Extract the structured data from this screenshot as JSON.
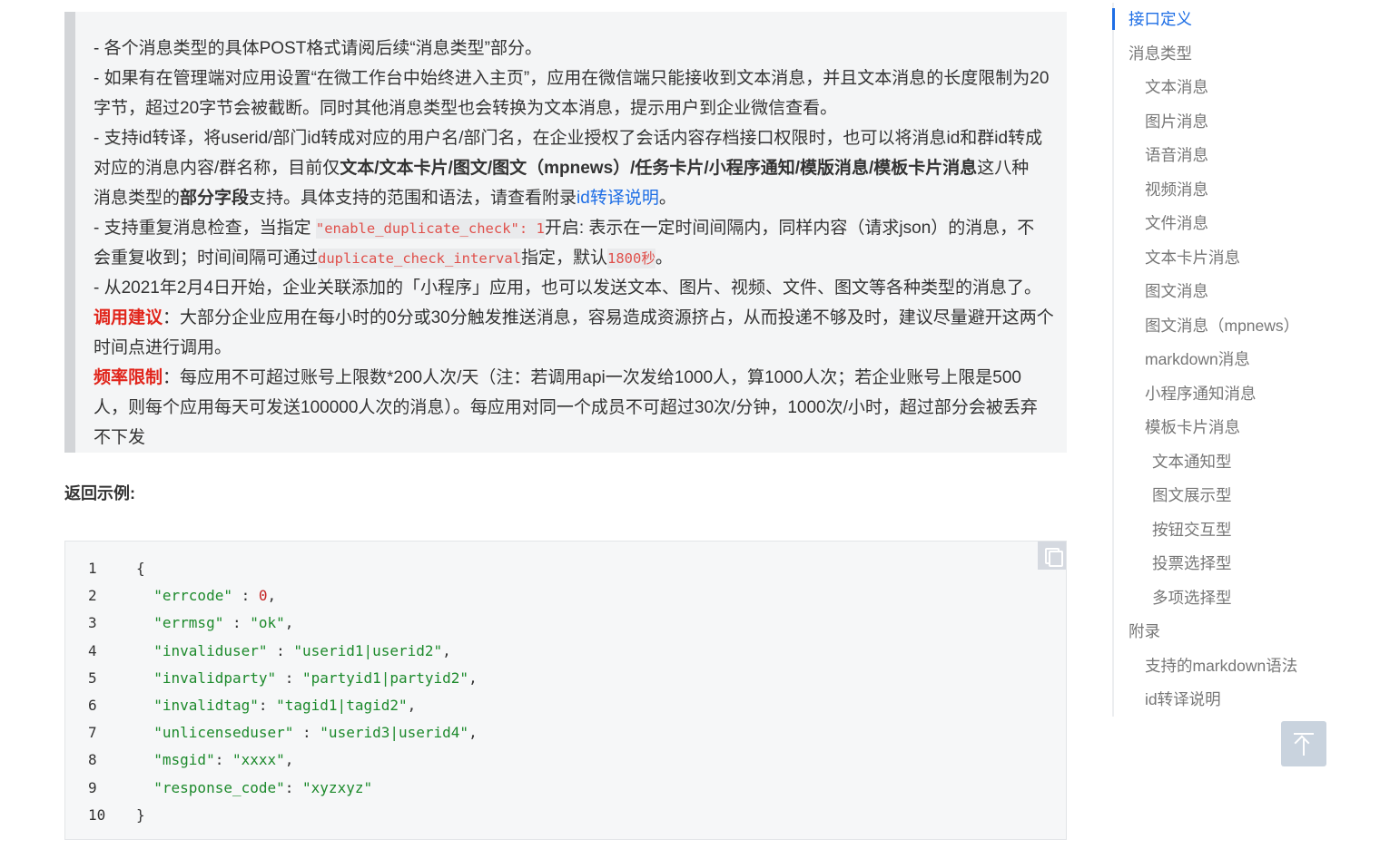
{
  "notice": {
    "line1": "- 各个消息类型的具体POST格式请阅后续“消息类型”部分。",
    "line2": "- 如果有在管理端对应用设置“在微工作台中始终进入主页”，应用在微信端只能接收到文本消息，并且文本消息的长度限制为20",
    "line3": "字节，超过20字节会被截断。同时其他消息类型也会转换为文本消息，提示用户到企业微信查看。",
    "line4": "- 支持id转译，将userid/部门id转成对应的用户名/部门名，在企业授权了会话内容存档接口权限时，也可以将消息id和群id转成",
    "line5_a": "对应的消息内容/群名称，目前仅",
    "line5_b": "文本/文本卡片/图文/图文（mpnews）/任务卡片/小程序通知/模版消息/模板卡片消息",
    "line5_c": "这八种",
    "line6_a": "消息类型的",
    "line6_b": "部分字段",
    "line6_c": "支持。具体支持的范围和语法，请查看附录",
    "line6_link": "id转译说明",
    "line6_d": "。",
    "line7_a": "- 支持重复消息检查，当指定 ",
    "line7_code": "\"enable_duplicate_check\": 1",
    "line7_b": "开启: 表示在一定时间间隔内，同样内容（请求json）的消息，不",
    "line8_a": "会重复收到；时间间隔可通过",
    "line8_code": "duplicate_check_interval",
    "line8_b": "指定，默认",
    "line8_code2": "1800秒",
    "line8_c": "。",
    "line9": "- 从2021年2月4日开始，企业关联添加的「小程序」应用，也可以发送文本、图片、视频、文件、图文等各种类型的消息了。",
    "line10_label": "调用建议",
    "line10_text": "：大部分企业应用在每小时的0分或30分触发推送消息，容易造成资源挤占，从而投递不够及时，建议尽量避开这两个",
    "line11": "时间点进行调用。",
    "line12_label": "频率限制",
    "line12_text": "：每应用不可超过账号上限数*200人次/天（注：若调用api一次发给1000人，算1000人次；若企业账号上限是500",
    "line13": "人，则每个应用每天可发送100000人次的消息）。每应用对同一个成员不可超过30次/分钟，1000次/小时，超过部分会被丢弃",
    "line14": "不下发"
  },
  "heading": "返回示例:",
  "code": {
    "line_numbers": [
      "1",
      "2",
      "3",
      "4",
      "5",
      "6",
      "7",
      "8",
      "9",
      "10"
    ],
    "open_brace": "{",
    "close_brace": "}",
    "entries": [
      {
        "key": "\"errcode\"",
        "sep": " : ",
        "value": "0",
        "comma": ","
      },
      {
        "key": "\"errmsg\"",
        "sep": " : ",
        "value": "\"ok\"",
        "comma": ","
      },
      {
        "key": "\"invaliduser\"",
        "sep": " : ",
        "value": "\"userid1|userid2\"",
        "comma": ","
      },
      {
        "key": "\"invalidparty\"",
        "sep": " : ",
        "value": "\"partyid1|partyid2\"",
        "comma": ","
      },
      {
        "key": "\"invalidtag\"",
        "sep": ": ",
        "value": "\"tagid1|tagid2\"",
        "comma": ","
      },
      {
        "key": "\"unlicenseduser\"",
        "sep": " : ",
        "value": "\"userid3|userid4\"",
        "comma": ","
      },
      {
        "key": "\"msgid\"",
        "sep": ": ",
        "value": "\"xxxx\"",
        "comma": ","
      },
      {
        "key": "\"response_code\"",
        "sep": ": ",
        "value": "\"xyzxyz\"",
        "comma": ""
      }
    ]
  },
  "toc": {
    "items": [
      {
        "label": "接口定义",
        "active": true
      },
      {
        "label": "消息类型"
      },
      {
        "label": "文本消息"
      },
      {
        "label": "图片消息"
      },
      {
        "label": "语音消息"
      },
      {
        "label": "视频消息"
      },
      {
        "label": "文件消息"
      },
      {
        "label": "文本卡片消息"
      },
      {
        "label": "图文消息"
      },
      {
        "label": "图文消息（mpnews）"
      },
      {
        "label": "markdown消息"
      },
      {
        "label": "小程序通知消息"
      },
      {
        "label": "模板卡片消息"
      },
      {
        "label": "文本通知型"
      },
      {
        "label": "图文展示型"
      },
      {
        "label": "按钮交互型"
      },
      {
        "label": "投票选择型"
      },
      {
        "label": "多项选择型"
      },
      {
        "label": "附录"
      },
      {
        "label": "支持的markdown语法"
      },
      {
        "label": "id转译说明"
      }
    ]
  },
  "colors": {
    "accent": "#1e6ee5",
    "warning_red": "#e1251b",
    "code_string": "#1d8a2c",
    "code_number": "#c42222"
  },
  "icons": {
    "copy": "copy-icon",
    "back_to_top": "arrow-up-icon"
  }
}
